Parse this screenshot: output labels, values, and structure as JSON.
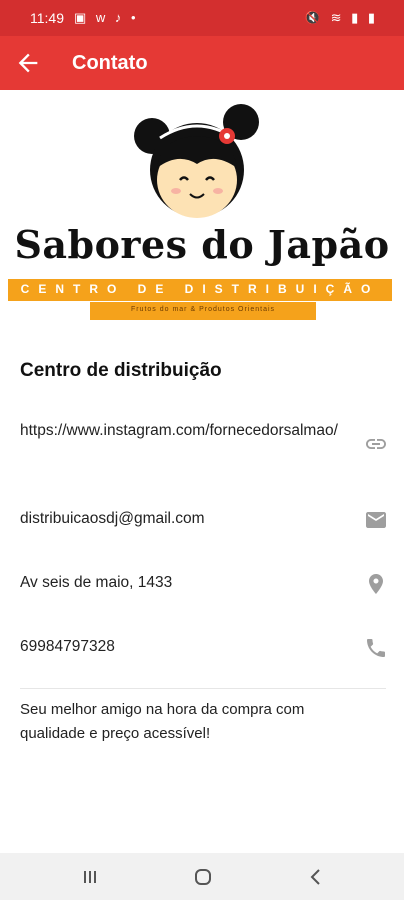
{
  "status_bar": {
    "time": "11:49",
    "left_icons": "▣ ᴡ ♪ •",
    "right_icons": "🔇 ≋ ▮ ▮"
  },
  "app_bar": {
    "title": "Contato"
  },
  "brand": {
    "name": "Sabores do Japão",
    "banner": "CENTRO DE DISTRIBUIÇÃO",
    "subtitle": "Frutos do mar & Produtos Orientais"
  },
  "section": {
    "title": "Centro de distribuição"
  },
  "contacts": [
    {
      "text": "https://www.instagram.com/fornecedorsalmao/",
      "icon": "link-icon"
    },
    {
      "text": "distribuicaosdj@gmail.com",
      "icon": "email-icon"
    },
    {
      "text": "Av seis de maio, 1433",
      "icon": "location-icon"
    },
    {
      "text": "69984797328",
      "icon": "phone-icon"
    }
  ],
  "description": "Seu melhor amigo na hora da compra com qualidade e preço acessível!",
  "colors": {
    "app_bar": "#e53935",
    "status_bar": "#d32f2f",
    "banner": "#f5a21b",
    "icon_gray": "#9e9e9e"
  }
}
